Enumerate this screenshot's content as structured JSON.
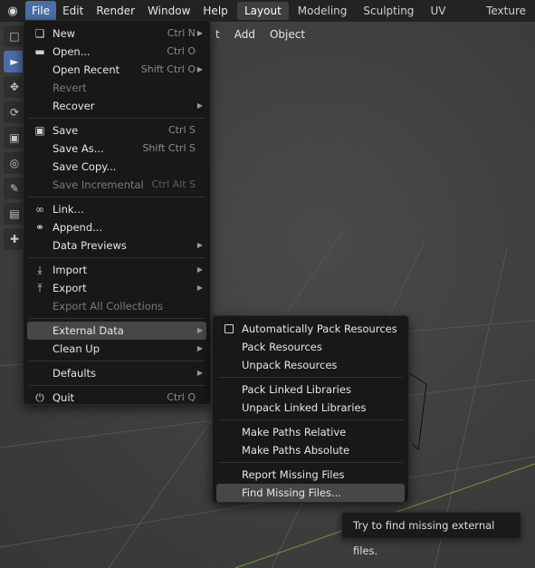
{
  "topbar": {
    "logo_icon": "blender-logo",
    "menus": [
      {
        "label": "File",
        "active": true
      },
      {
        "label": "Edit"
      },
      {
        "label": "Render"
      },
      {
        "label": "Window"
      },
      {
        "label": "Help"
      }
    ],
    "workspaces": [
      {
        "label": "Layout",
        "active": true
      },
      {
        "label": "Modeling"
      },
      {
        "label": "Sculpting"
      },
      {
        "label": "UV Editing"
      },
      {
        "label": "Texture P"
      }
    ]
  },
  "viewport_header": {
    "partial_label": "t",
    "add": "Add",
    "object": "Object"
  },
  "file_menu": {
    "new": {
      "label": "New",
      "shortcut": "Ctrl N"
    },
    "open": {
      "label": "Open...",
      "shortcut": "Ctrl O"
    },
    "open_recent": {
      "label": "Open Recent",
      "shortcut": "Shift Ctrl O"
    },
    "revert": {
      "label": "Revert"
    },
    "recover": {
      "label": "Recover"
    },
    "save": {
      "label": "Save",
      "shortcut": "Ctrl S"
    },
    "save_as": {
      "label": "Save As...",
      "shortcut": "Shift Ctrl S"
    },
    "save_copy": {
      "label": "Save Copy..."
    },
    "save_incremental": {
      "label": "Save Incremental",
      "shortcut": "Ctrl Alt S"
    },
    "link": {
      "label": "Link..."
    },
    "append": {
      "label": "Append..."
    },
    "data_previews": {
      "label": "Data Previews"
    },
    "import": {
      "label": "Import"
    },
    "export": {
      "label": "Export"
    },
    "export_all": {
      "label": "Export All Collections"
    },
    "external_data": {
      "label": "External Data"
    },
    "clean_up": {
      "label": "Clean Up"
    },
    "defaults": {
      "label": "Defaults"
    },
    "quit": {
      "label": "Quit",
      "shortcut": "Ctrl Q"
    }
  },
  "external_data_menu": {
    "auto_pack": {
      "label": "Automatically Pack Resources",
      "checked": false
    },
    "pack": {
      "label": "Pack Resources"
    },
    "unpack": {
      "label": "Unpack Resources"
    },
    "pack_linked": {
      "label": "Pack Linked Libraries"
    },
    "unpack_linked": {
      "label": "Unpack Linked Libraries"
    },
    "make_relative": {
      "label": "Make Paths Relative"
    },
    "make_absolute": {
      "label": "Make Paths Absolute"
    },
    "report_missing": {
      "label": "Report Missing Files"
    },
    "find_missing": {
      "label": "Find Missing Files..."
    }
  },
  "tooltip": {
    "text": "Try to find missing external files."
  },
  "colors": {
    "accent": "#4b6ea8",
    "menu_bg": "#181818",
    "highlight": "#474747"
  }
}
